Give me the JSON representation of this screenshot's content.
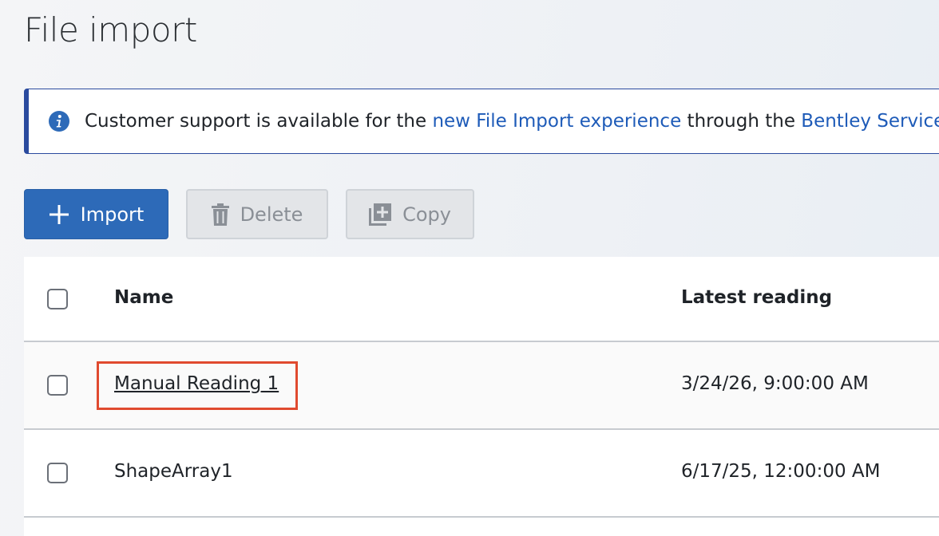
{
  "page": {
    "title": "File import"
  },
  "banner": {
    "text_before": "Customer support is available for the ",
    "link1": "new File Import experience",
    "text_middle": " through the ",
    "link2": "Bentley Services"
  },
  "toolbar": {
    "import_label": "Import",
    "delete_label": "Delete",
    "copy_label": "Copy"
  },
  "table": {
    "columns": [
      "Name",
      "Latest reading"
    ],
    "rows": [
      {
        "name": "Manual Reading 1",
        "latest_reading": "3/24/26, 9:00:00 AM",
        "is_link": true,
        "highlighted": true
      },
      {
        "name": "ShapeArray1",
        "latest_reading": "6/17/25, 12:00:00 AM",
        "is_link": false,
        "highlighted": false
      }
    ]
  },
  "colors": {
    "primary": "#2d6ab8",
    "info": "#2a4a9e",
    "link": "#1e5bb8",
    "highlight": "#e04a2f"
  },
  "icons": {
    "banner": "info-icon",
    "import": "plus-icon",
    "delete": "trash-icon",
    "copy": "copy-icon"
  }
}
